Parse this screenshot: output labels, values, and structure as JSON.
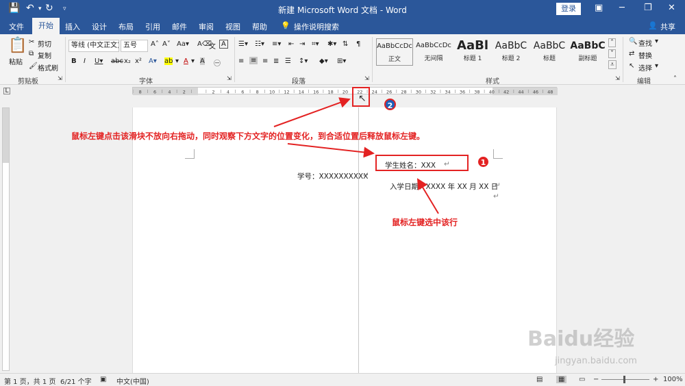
{
  "titlebar": {
    "title": "新建 Microsoft Word 文档 - Word",
    "login": "登录"
  },
  "tabs": [
    "文件",
    "开始",
    "插入",
    "设计",
    "布局",
    "引用",
    "邮件",
    "审阅",
    "视图",
    "帮助",
    "操作说明搜索"
  ],
  "share": "共享",
  "ribbon": {
    "clipboard": {
      "paste": "粘贴",
      "cut": "剪切",
      "copy": "复制",
      "format_painter": "格式刷",
      "label": "剪贴板"
    },
    "font": {
      "font_name": "等线 (中文正文)",
      "font_size": "五号",
      "label": "字体"
    },
    "paragraph": {
      "label": "段落"
    },
    "styles": {
      "items": [
        {
          "preview": "AaBbCcDc",
          "name": "正文"
        },
        {
          "preview": "AaBbCcDc",
          "name": "无间隔"
        },
        {
          "preview": "AaBl",
          "name": "标题 1"
        },
        {
          "preview": "AaBbC",
          "name": "标题 2"
        },
        {
          "preview": "AaBbC",
          "name": "标题"
        },
        {
          "preview": "AaBbC",
          "name": "副标题"
        }
      ],
      "label": "样式"
    },
    "editing": {
      "find": "查找",
      "replace": "替换",
      "select": "选择",
      "label": "编辑"
    }
  },
  "ruler_labels": [
    "8",
    "6",
    "4",
    "2",
    "",
    "2",
    "4",
    "6",
    "8",
    "10",
    "12",
    "14",
    "16",
    "18",
    "20",
    "22",
    "24",
    "26",
    "28",
    "30",
    "32",
    "34",
    "36",
    "38",
    "40",
    "42",
    "44",
    "46",
    "48"
  ],
  "document": {
    "student_name": "学生姓名：XXX",
    "student_id": "学号：XXXXXXXXXX",
    "enroll_date": "入学日期：XXXX 年 XX 月 XX 日"
  },
  "annotations": {
    "drag_hint": "鼠标左键点击该滑块不放向右拖动，同时观察下方文字的位置变化，到合适位置后释放鼠标左键。",
    "select_hint": "鼠标左键选中该行",
    "badge1": "1",
    "badge2": "2"
  },
  "status": {
    "page": "第 1 页，共 1 页",
    "words": "6/21 个字",
    "language": "中文(中国)",
    "zoom": "100%"
  },
  "watermark": {
    "brand": "Baidu经验",
    "url": "jingyan.baidu.com"
  }
}
